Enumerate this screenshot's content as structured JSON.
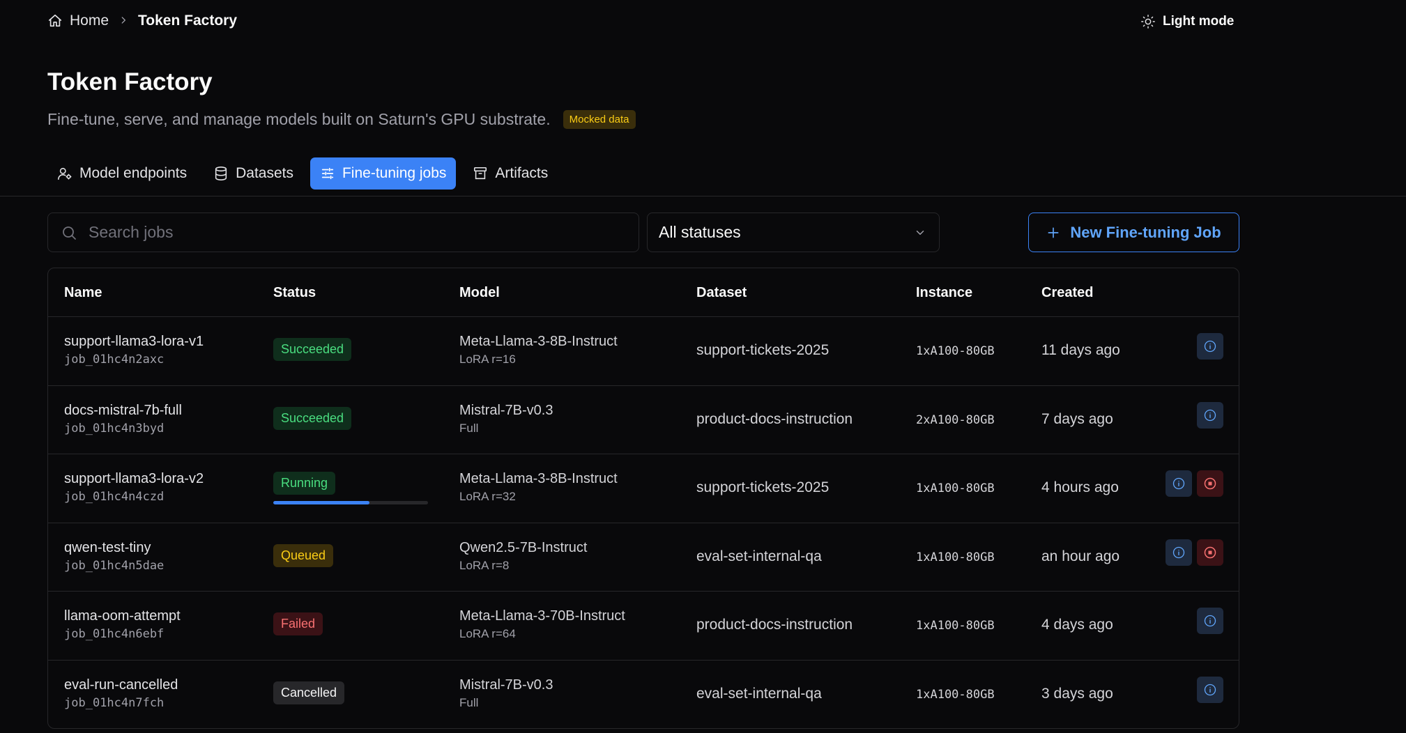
{
  "breadcrumb": {
    "home": "Home",
    "current": "Token Factory"
  },
  "theme_toggle": "Light mode",
  "header": {
    "title": "Token Factory",
    "subtitle": "Fine-tune, serve, and manage models built on Saturn's GPU substrate.",
    "badge": "Mocked data"
  },
  "tabs": [
    {
      "label": "Model endpoints",
      "icon": "user-cog-icon"
    },
    {
      "label": "Datasets",
      "icon": "database-icon"
    },
    {
      "label": "Fine-tuning jobs",
      "icon": "sliders-icon",
      "active": true
    },
    {
      "label": "Artifacts",
      "icon": "archive-icon"
    }
  ],
  "toolbar": {
    "search_placeholder": "Search jobs",
    "status_filter": "All statuses",
    "new_job_label": "New Fine-tuning Job"
  },
  "table": {
    "columns": [
      "Name",
      "Status",
      "Model",
      "Dataset",
      "Instance",
      "Created"
    ],
    "rows": [
      {
        "name": "support-llama3-lora-v1",
        "job_id": "job_01hc4n2axc",
        "status": "Succeeded",
        "model": "Meta-Llama-3-8B-Instruct",
        "method": "LoRA r=16",
        "dataset": "support-tickets-2025",
        "instance": "1xA100-80GB",
        "created": "11 days ago",
        "actions": [
          "info"
        ]
      },
      {
        "name": "docs-mistral-7b-full",
        "job_id": "job_01hc4n3byd",
        "status": "Succeeded",
        "model": "Mistral-7B-v0.3",
        "method": "Full",
        "dataset": "product-docs-instruction",
        "instance": "2xA100-80GB",
        "created": "7 days ago",
        "actions": [
          "info"
        ]
      },
      {
        "name": "support-llama3-lora-v2",
        "job_id": "job_01hc4n4czd",
        "status": "Running",
        "progress": 0.62,
        "model": "Meta-Llama-3-8B-Instruct",
        "method": "LoRA r=32",
        "dataset": "support-tickets-2025",
        "instance": "1xA100-80GB",
        "created": "4 hours ago",
        "actions": [
          "info",
          "stop"
        ]
      },
      {
        "name": "qwen-test-tiny",
        "job_id": "job_01hc4n5dae",
        "status": "Queued",
        "model": "Qwen2.5-7B-Instruct",
        "method": "LoRA r=8",
        "dataset": "eval-set-internal-qa",
        "instance": "1xA100-80GB",
        "created": "an hour ago",
        "actions": [
          "info",
          "stop"
        ]
      },
      {
        "name": "llama-oom-attempt",
        "job_id": "job_01hc4n6ebf",
        "status": "Failed",
        "model": "Meta-Llama-3-70B-Instruct",
        "method": "LoRA r=64",
        "dataset": "product-docs-instruction",
        "instance": "1xA100-80GB",
        "created": "4 days ago",
        "actions": [
          "info"
        ]
      },
      {
        "name": "eval-run-cancelled",
        "job_id": "job_01hc4n7fch",
        "status": "Cancelled",
        "model": "Mistral-7B-v0.3",
        "method": "Full",
        "dataset": "eval-set-internal-qa",
        "instance": "1xA100-80GB",
        "created": "3 days ago",
        "actions": [
          "info"
        ]
      }
    ]
  },
  "colors": {
    "accent": "#3b82f6",
    "background": "#09090b",
    "border": "#27272a"
  }
}
